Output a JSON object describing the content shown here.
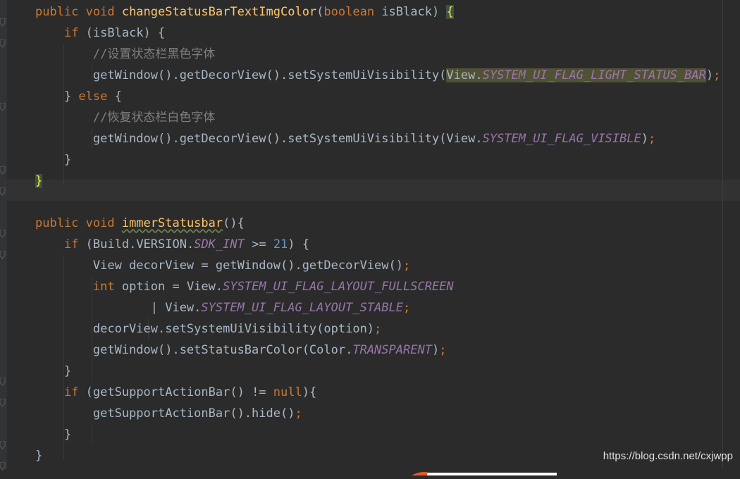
{
  "code": {
    "lines": [
      {
        "parts": [
          {
            "t": "public void ",
            "c": "kw"
          },
          {
            "t": "changeStatusBarTextImgColor",
            "c": "fn"
          },
          {
            "t": "("
          },
          {
            "t": "boolean ",
            "c": "kw"
          },
          {
            "t": "isBlack) "
          },
          {
            "t": "{",
            "c": "brace-hl"
          }
        ]
      },
      {
        "parts": [
          {
            "t": "    "
          },
          {
            "t": "if ",
            "c": "kw"
          },
          {
            "t": "(isBlack) {"
          }
        ]
      },
      {
        "parts": [
          {
            "t": "        "
          },
          {
            "t": "//设置状态栏黑色字体",
            "c": "cm"
          }
        ]
      },
      {
        "parts": [
          {
            "t": "        getWindow().getDecorView().setSystemUiVisibility("
          },
          {
            "t": "View.",
            "c": "sel"
          },
          {
            "t": "SYSTEM_UI_FLAG_LIGHT_STATUS_BAR",
            "c": "st sel"
          },
          {
            "t": ")"
          },
          {
            "t": ";",
            "c": "kw"
          }
        ]
      },
      {
        "parts": [
          {
            "t": "    } "
          },
          {
            "t": "else ",
            "c": "kw"
          },
          {
            "t": "{"
          }
        ]
      },
      {
        "parts": [
          {
            "t": "        "
          },
          {
            "t": "//恢复状态栏白色字体",
            "c": "cm"
          }
        ]
      },
      {
        "parts": [
          {
            "t": "        getWindow().getDecorView().setSystemUiVisibility(View."
          },
          {
            "t": "SYSTEM_UI_FLAG_VISIBLE",
            "c": "st"
          },
          {
            "t": ")"
          },
          {
            "t": ";",
            "c": "kw"
          }
        ]
      },
      {
        "parts": [
          {
            "t": "    }"
          }
        ]
      },
      {
        "parts": [
          {
            "t": "}",
            "c": "brace-hl"
          }
        ]
      },
      {
        "parts": [
          {
            "t": ""
          }
        ]
      },
      {
        "parts": [
          {
            "t": "public void ",
            "c": "kw"
          },
          {
            "t": "immerStatusbar",
            "c": "fn wavy"
          },
          {
            "t": "(){"
          }
        ]
      },
      {
        "parts": [
          {
            "t": "    "
          },
          {
            "t": "if ",
            "c": "kw"
          },
          {
            "t": "(Build.VERSION."
          },
          {
            "t": "SDK_INT",
            "c": "st"
          },
          {
            "t": " >= "
          },
          {
            "t": "21",
            "c": "num"
          },
          {
            "t": ") {"
          }
        ]
      },
      {
        "parts": [
          {
            "t": "        View decorView = getWindow().getDecorView()"
          },
          {
            "t": ";",
            "c": "kw"
          }
        ]
      },
      {
        "parts": [
          {
            "t": "        "
          },
          {
            "t": "int ",
            "c": "kw"
          },
          {
            "t": "option = View."
          },
          {
            "t": "SYSTEM_UI_FLAG_LAYOUT_FULLSCREEN",
            "c": "st"
          }
        ]
      },
      {
        "parts": [
          {
            "t": "                | View."
          },
          {
            "t": "SYSTEM_UI_FLAG_LAYOUT_STABLE",
            "c": "st"
          },
          {
            "t": ";",
            "c": "kw"
          }
        ]
      },
      {
        "parts": [
          {
            "t": "        decorView.setSystemUiVisibility(option)"
          },
          {
            "t": ";",
            "c": "kw"
          }
        ]
      },
      {
        "parts": [
          {
            "t": "        getWindow().setStatusBarColor(Color."
          },
          {
            "t": "TRANSPARENT",
            "c": "st"
          },
          {
            "t": ")"
          },
          {
            "t": ";",
            "c": "kw"
          }
        ]
      },
      {
        "parts": [
          {
            "t": "    }"
          }
        ]
      },
      {
        "parts": [
          {
            "t": "    "
          },
          {
            "t": "if ",
            "c": "kw"
          },
          {
            "t": "(getSupportActionBar() != "
          },
          {
            "t": "null",
            "c": "kw"
          },
          {
            "t": "){"
          }
        ]
      },
      {
        "parts": [
          {
            "t": "        getSupportActionBar().hide()"
          },
          {
            "t": ";",
            "c": "kw"
          }
        ]
      },
      {
        "parts": [
          {
            "t": "    }"
          }
        ]
      },
      {
        "parts": [
          {
            "t": "}"
          }
        ]
      }
    ]
  },
  "watermark": "https://blog.csdn.net/cxjwpp",
  "colors": {
    "background": "#2b2b2b",
    "keyword": "#cc7832",
    "method": "#ffc66d",
    "comment": "#808080",
    "number": "#6897bb",
    "static_field": "#9876aa",
    "text": "#a9b7c6"
  }
}
